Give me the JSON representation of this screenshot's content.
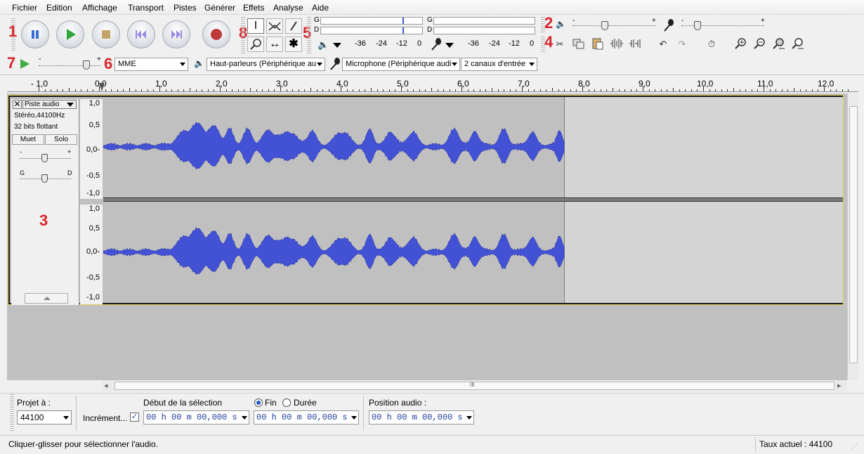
{
  "menu": [
    "Fichier",
    "Edition",
    "Affichage",
    "Transport",
    "Pistes",
    "Générer",
    "Effets",
    "Analyse",
    "Aide"
  ],
  "annotations": {
    "n1": "1",
    "n2": "2",
    "n3": "3",
    "n4": "4",
    "n5": "5",
    "n6": "6",
    "n7": "7",
    "n8": "8"
  },
  "meters": {
    "left_label": "G",
    "right_label": "D",
    "playback_ticks": [
      "-36",
      "-24",
      "-12",
      "0"
    ],
    "record_ticks": [
      "-36",
      "-24",
      "-12",
      "0"
    ]
  },
  "mixer": {
    "minus": "-",
    "plus": "+"
  },
  "device": {
    "host": "MME",
    "output": "Haut-parleurs (Périphérique au",
    "input": "Microphone (Périphérique audi",
    "channels": "2 canaux d'entrée"
  },
  "play_speed": {
    "minus": "-",
    "plus": "+"
  },
  "ruler_ticks": [
    "- 1,0",
    "0,0",
    "1,0",
    "2,0",
    "3,0",
    "4,0",
    "5,0",
    "6,0",
    "7,0",
    "8,0",
    "9,0",
    "10,0",
    "11,0",
    "12,0"
  ],
  "track": {
    "name": "Piste audio",
    "format": "Stéréo,44100Hz",
    "bits": "32 bits flottant",
    "mute": "Muet",
    "solo": "Solo",
    "gain_minus": "-",
    "gain_plus": "+",
    "pan_left": "G",
    "pan_right": "D",
    "scale": [
      "1,0",
      "0,5",
      "0,0-",
      "-0,5",
      "-1,0"
    ]
  },
  "selection_bar": {
    "project_rate_label": "Projet à :",
    "project_rate": "44100",
    "snap_label": "Incrément...",
    "sel_start_label": "Début de la sélection",
    "end_label": "Fin",
    "length_label": "Durée",
    "sel_start": "00 h 00 m 00,000 s",
    "sel_end": "00 h 00 m 00,000 s",
    "audio_pos_label": "Position audio :",
    "audio_pos": "00 h 00 m 00,000 s"
  },
  "scroll": {
    "left": "◂",
    "right": "▸",
    "grip": "III"
  },
  "status": {
    "message": "Cliquer-glisser pour sélectionner l'audio.",
    "rate": "Taux actuel : 44100"
  },
  "colors": {
    "wave": "#3f4fd0",
    "annotation": "#d8262c",
    "track_bg": "#c0c0c0"
  }
}
